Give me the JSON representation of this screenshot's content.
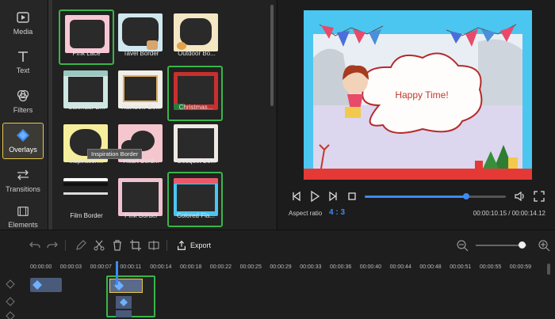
{
  "sidebar": {
    "items": [
      {
        "label": "Media",
        "icon": "media-icon"
      },
      {
        "label": "Text",
        "icon": "text-icon"
      },
      {
        "label": "Filters",
        "icon": "filters-icon"
      },
      {
        "label": "Overlays",
        "icon": "overlays-icon",
        "active": true
      },
      {
        "label": "Transitions",
        "icon": "transitions-icon"
      },
      {
        "label": "Elements",
        "icon": "elements-icon"
      }
    ]
  },
  "overlays": {
    "items": [
      {
        "label": "Pink Lace",
        "selected": true
      },
      {
        "label": "Tavel Border",
        "selected": false
      },
      {
        "label": "Outdoor Bo...",
        "selected": false
      },
      {
        "label": "Calendar B...",
        "selected": false
      },
      {
        "label": "Rainbow Bo...",
        "selected": false
      },
      {
        "label": "Christmas...",
        "selected": true
      },
      {
        "label": "Inspiration...",
        "selected": false
      },
      {
        "label": "Heart Bord...",
        "selected": false
      },
      {
        "label": "Bouquet Bo...",
        "selected": false
      },
      {
        "label": "Film Border",
        "selected": false
      },
      {
        "label": "Pink Border",
        "selected": false
      },
      {
        "label": "Colored Fla...",
        "selected": true
      }
    ],
    "tooltip": "Inspiration Border"
  },
  "preview": {
    "caption": "Happy Time!",
    "progress": 0.72,
    "aspect_ratio_label": "Aspect ratio",
    "aspect_ratio_value": "4 : 3",
    "time": "00:00:10.15 / 00:00:14.12"
  },
  "toolbar": {
    "export_label": "Export"
  },
  "timeline": {
    "ruler": [
      "00:00:00",
      "00:00:03",
      "00:00:07",
      "00:00:11",
      "00:00:14",
      "00:00:18",
      "00:00:22",
      "00:00:25",
      "00:00:29",
      "00:00:33",
      "00:00:36",
      "00:00:40",
      "00:00:44",
      "00:00:48",
      "00:00:51",
      "00:00:55",
      "00:00:59"
    ],
    "zoom": 0.9
  },
  "colors": {
    "accent": "#3d8bf2",
    "selection": "#39b54a",
    "active_tab": "#e8c84a"
  }
}
